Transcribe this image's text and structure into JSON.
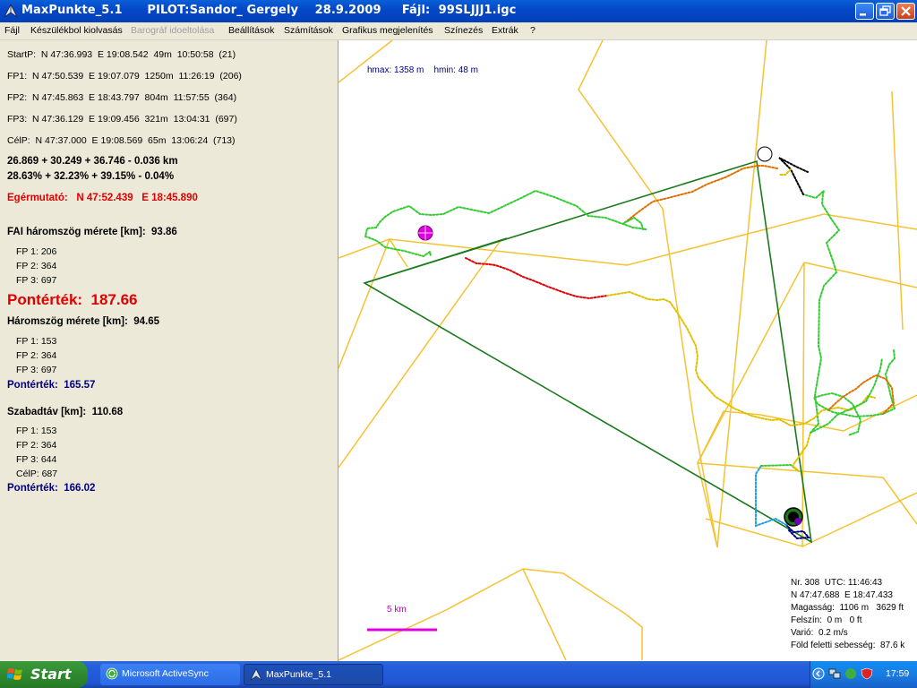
{
  "window": {
    "title": "MaxPunkte_5.1      PILOT:Sandor_ Gergely    28.9.2009     Fájl:  99SLJJJ1.igc"
  },
  "menu": [
    {
      "label": "Fájl",
      "enabled": true
    },
    {
      "label": "Készülékbol kiolvasás",
      "enabled": true
    },
    {
      "label": "Barográf idoeltolása",
      "enabled": false
    },
    {
      "label": "Beállítások",
      "enabled": true
    },
    {
      "label": "Számítások",
      "enabled": true
    },
    {
      "label": "Grafikus megjelenítés",
      "enabled": true
    },
    {
      "label": "Színezés",
      "enabled": true
    },
    {
      "label": "Extrák",
      "enabled": true
    },
    {
      "label": "?",
      "enabled": true
    }
  ],
  "points": {
    "start": "StartP:  N 47:36.993  E 19:08.542  49m  10:50:58  (21)",
    "fp1": "FP1:  N 47:50.539  E 19:07.079  1250m  11:26:19  (206)",
    "fp2": "FP2:  N 47:45.863  E 18:43.797  804m  11:57:55  (364)",
    "fp3": "FP3:  N 47:36.129  E 19:09.456  321m  13:04:31  (697)",
    "cel": "CélP:  N 47:37.000  E 19:08.569  65m  13:06:24  (713)"
  },
  "sums": {
    "km": "26.869 + 30.249 + 36.746 - 0.036 km",
    "pct": "28.63% + 32.23% + 39.15% - 0.04%"
  },
  "mouse": {
    "label": "Egérmutató:",
    "value": "N 47:52.439   E 18:45.890"
  },
  "fai": {
    "title": "FAI háromszög mérete [km]:  93.86",
    "fp": [
      "FP 1: 206",
      "FP 2: 364",
      "FP 3: 697"
    ],
    "points": "Pontérték:  187.66"
  },
  "tri": {
    "title": "Háromszög mérete [km]:  94.65",
    "fp": [
      "FP 1: 153",
      "FP 2: 364",
      "FP 3: 697"
    ],
    "points": "Pontérték:  165.57"
  },
  "free": {
    "title": "Szabadtáv [km]:  110.68",
    "fp": [
      "FP 1: 153",
      "FP 2: 364",
      "FP 3: 644",
      "CélP: 687"
    ],
    "points": "Pontérték:  166.02"
  },
  "map": {
    "hmax": "hmax: 1358 m",
    "hmin": "hmin: 48 m",
    "scale": "5 km",
    "info": {
      "nr": "Nr. 308  UTC: 11:46:43",
      "pos": "N 47:47.688  E 18:47.433",
      "alt": "Magasság:  1106 m   3629 ft",
      "ground": "Felszín:  0 m   0 ft",
      "vario": "Varió:  0.2 m/s",
      "speed": "Föld feletti sebesség:  87.6 k"
    },
    "colors": {
      "airspace": "#f5c232",
      "triangle": "#1a7a1a",
      "scale": "#e000e0",
      "marker": "#e000e0"
    }
  },
  "taskbar": {
    "start": "Start",
    "items": [
      "Microsoft ActiveSync",
      "MaxPunkte_5.1"
    ],
    "clock": "17:59"
  }
}
